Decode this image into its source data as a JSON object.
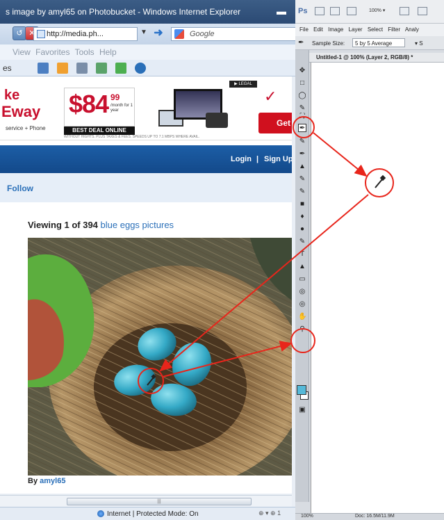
{
  "ie": {
    "title": "s image by amyl65 on Photobucket - Windows Internet Explorer",
    "url": "http://media.ph...",
    "search_placeholder": "Google",
    "menu": "View  Favorites  Tools  Help",
    "cmd_partial": "es",
    "status": "Internet | Protected Mode: On",
    "zoom": "⊕ ▾  ⊕ 1"
  },
  "banner": {
    "ke": "ke",
    "eway": "Eway",
    "service": "service + Phone",
    "price": "$84",
    "cents": "99",
    "per_month": "/month for 1 year",
    "deal": "BEST DEAL ONLINE",
    "fine_print": "WITHOUT HIGHTS. PLUS TAXES & FEES. SPEEDS UP TO 7.1 MBPS WHERE AVAIL.",
    "legal": "▶ LEGAL",
    "get": "Get"
  },
  "site": {
    "login": "Login",
    "separator": "|",
    "signup": "Sign Up",
    "follow": "Follow",
    "viewing": "Viewing 1 of 394",
    "viewing_link": "blue eggs pictures",
    "by": "By",
    "by_user": "amyl65"
  },
  "ps": {
    "logo": "Ps",
    "zoom": "100% ▾",
    "menu": "File Edit Image Layer Select Filter Analy",
    "option_label": "Sample Size:",
    "option_value": "5 by 5 Average",
    "option_extra": "▾ S",
    "doc_tab": "Untitled-1 @ 100% (Layer 2, RGB/8) *",
    "status_zoom": "100%",
    "status_doc": "Doc: 16.5M/11.9M",
    "foreground_color": "#56b9d8"
  }
}
